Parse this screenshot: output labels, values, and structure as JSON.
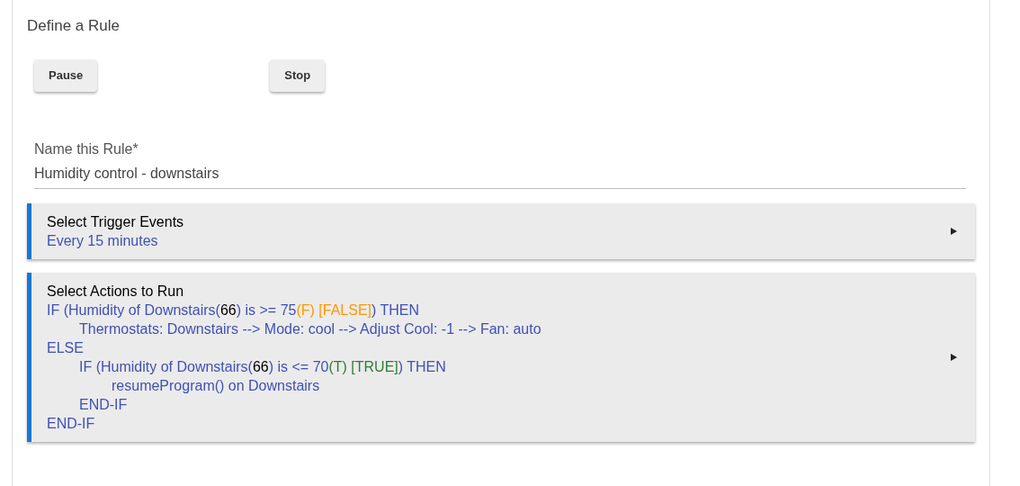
{
  "title": "Define a Rule",
  "buttons": [
    {
      "label": "Pause"
    },
    {
      "label": "Stop"
    }
  ],
  "name_field": {
    "label": "Name this Rule*",
    "value": "Humidity control - downstairs"
  },
  "sections": [
    {
      "title": "Select Trigger Events",
      "lines": [
        {
          "segments": [
            {
              "kind": "text",
              "text": "Every 15 minutes"
            }
          ]
        }
      ]
    },
    {
      "title": "Select Actions to Run",
      "lines": [
        {
          "segments": [
            {
              "kind": "text",
              "text": "IF (Humidity of Downstairs("
            },
            {
              "kind": "value",
              "text": "66"
            },
            {
              "kind": "text",
              "text": ") is >= 75"
            },
            {
              "kind": "false",
              "text": "(F) [FALSE]"
            },
            {
              "kind": "text",
              "text": ") THEN"
            }
          ],
          "children": [
            {
              "segments": [
                {
                  "kind": "text",
                  "text": "Thermostats: Downstairs --> Mode: cool --> Adjust Cool: -1 --> Fan: auto"
                }
              ]
            }
          ]
        },
        {
          "segments": [
            {
              "kind": "text",
              "text": "ELSE"
            }
          ],
          "children": [
            {
              "segments": [
                {
                  "kind": "text",
                  "text": "IF (Humidity of Downstairs("
                },
                {
                  "kind": "value",
                  "text": "66"
                },
                {
                  "kind": "text",
                  "text": ") is <= 70"
                },
                {
                  "kind": "true",
                  "text": "(T) [TRUE]"
                },
                {
                  "kind": "text",
                  "text": ") THEN"
                }
              ],
              "children": [
                {
                  "segments": [
                    {
                      "kind": "text",
                      "text": "resumeProgram() on Downstairs"
                    }
                  ]
                }
              ]
            },
            {
              "segments": [
                {
                  "kind": "text",
                  "text": "END-IF"
                }
              ]
            }
          ]
        },
        {
          "segments": [
            {
              "kind": "text",
              "text": "END-IF"
            }
          ]
        }
      ]
    }
  ]
}
